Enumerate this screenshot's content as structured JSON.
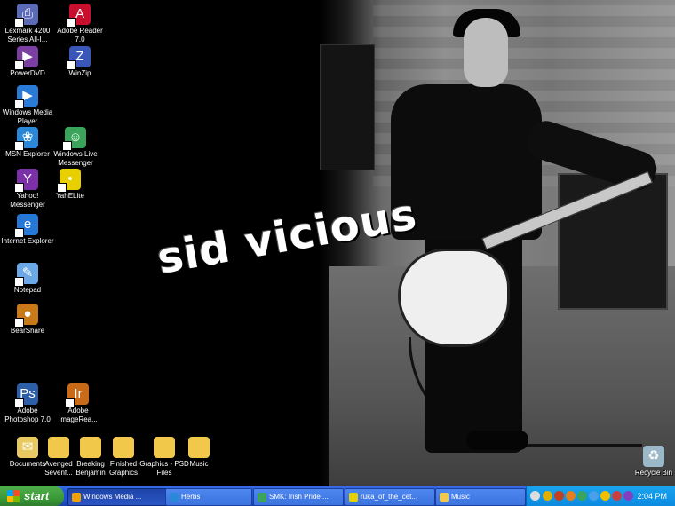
{
  "wallpaper": {
    "title": "sid vicious"
  },
  "desktop_icons": [
    {
      "label": "Lexmark 4200 Series All-I...",
      "icon": "printer-icon",
      "color": "#5b6bb8",
      "glyph": "⎙"
    },
    {
      "label": "Adobe Reader 7.0",
      "icon": "adobe-reader-icon",
      "color": "#c8102e",
      "glyph": "A"
    },
    {
      "label": "PowerDVD",
      "icon": "powerdvd-icon",
      "color": "#7a3fa0",
      "glyph": "▶"
    },
    {
      "label": "WinZip",
      "icon": "winzip-icon",
      "color": "#3a56b8",
      "glyph": "Z"
    },
    {
      "label": "Windows Media Player",
      "icon": "media-player-icon",
      "color": "#2a7ad8",
      "glyph": "▶"
    },
    {
      "label": "MSN Explorer",
      "icon": "msn-icon",
      "color": "#2a88d8",
      "glyph": "❀"
    },
    {
      "label": "Windows Live Messenger",
      "icon": "live-messenger-icon",
      "color": "#3aa55a",
      "glyph": "☺"
    },
    {
      "label": "Yahoo! Messenger",
      "icon": "yahoo-messenger-icon",
      "color": "#7b2fa8",
      "glyph": "Y"
    },
    {
      "label": "YahELite",
      "icon": "yahelite-icon",
      "color": "#e8d000",
      "glyph": "•"
    },
    {
      "label": "Internet Explorer",
      "icon": "internet-explorer-icon",
      "color": "#2577d8",
      "glyph": "e"
    },
    {
      "label": "Notepad",
      "icon": "notepad-icon",
      "color": "#6aa8e8",
      "glyph": "✎"
    },
    {
      "label": "BearShare",
      "icon": "bearshare-icon",
      "color": "#c87a18",
      "glyph": "●"
    },
    {
      "label": "Adobe Photoshop 7.0",
      "icon": "photoshop-icon",
      "color": "#2c5fa8",
      "glyph": "Ps"
    },
    {
      "label": "Adobe ImageRea...",
      "icon": "imageready-icon",
      "color": "#c86a18",
      "glyph": "Ir"
    },
    {
      "label": "Documents",
      "icon": "documents-icon",
      "color": "#e8c860",
      "glyph": "✉"
    },
    {
      "label": "Avenged Sevenf...",
      "icon": "folder-icon",
      "color": "#f1c84a",
      "glyph": ""
    },
    {
      "label": "Breaking Benjamin",
      "icon": "folder-icon",
      "color": "#f1c84a",
      "glyph": ""
    },
    {
      "label": "Finished Graphics",
      "icon": "folder-icon",
      "color": "#f1c84a",
      "glyph": ""
    },
    {
      "label": "Graphics - PSD Files",
      "icon": "folder-icon",
      "color": "#f1c84a",
      "glyph": ""
    },
    {
      "label": "Music",
      "icon": "folder-icon",
      "color": "#f1c84a",
      "glyph": ""
    },
    {
      "label": "Recycle Bin",
      "icon": "recycle-bin-icon",
      "color": "#9ab8c8",
      "glyph": "♻"
    }
  ],
  "taskbar": {
    "start_label": "start",
    "tasks": [
      {
        "label": "Windows Media ...",
        "icon": "media-player-icon",
        "color": "#f0a000",
        "active": true
      },
      {
        "label": "Herbs",
        "icon": "msn-icon",
        "color": "#2a88d8",
        "active": false
      },
      {
        "label": "SMK: Irish Pride ...",
        "icon": "live-messenger-icon",
        "color": "#3aa55a",
        "active": false
      },
      {
        "label": "ruka_of_the_cet...",
        "icon": "yahelite-icon",
        "color": "#e8d000",
        "active": false
      },
      {
        "label": "Music",
        "icon": "folder-icon",
        "color": "#f1c84a",
        "active": false
      }
    ],
    "clock": "2:04 PM"
  }
}
